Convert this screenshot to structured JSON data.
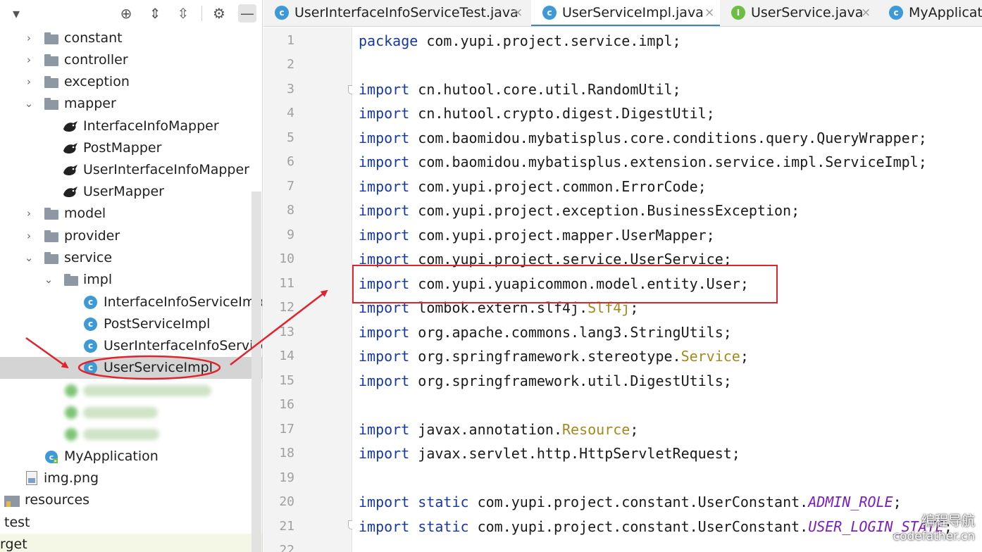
{
  "toolbar": {
    "icons": [
      "chevron-down-icon",
      "crosshair-icon",
      "expand-all-icon",
      "collapse-all-icon",
      "gear-icon",
      "minimize-icon"
    ]
  },
  "tree": {
    "constant": "constant",
    "controller": "controller",
    "exception": "exception",
    "mapper": "mapper",
    "interface_info_mapper": "InterfaceInfoMapper",
    "post_mapper": "PostMapper",
    "user_interface_info_mapper": "UserInterfaceInfoMapper",
    "user_mapper": "UserMapper",
    "model": "model",
    "provider": "provider",
    "service": "service",
    "impl": "impl",
    "interface_info_service_impl": "InterfaceInfoServiceImpl",
    "post_service_impl": "PostServiceImpl",
    "user_interface_info_service_impl": "UserInterfaceInfoServiceImpl",
    "user_service_impl": "UserServiceImpl",
    "my_application": "MyApplication",
    "img_png": "img.png",
    "resources": "resources",
    "test": "test",
    "target": "rget"
  },
  "tabs": [
    {
      "label": "UserInterfaceInfoServiceTest.java",
      "icon": "class-icon",
      "active": false,
      "close": "×"
    },
    {
      "label": "UserServiceImpl.java",
      "icon": "class-icon",
      "active": true,
      "close": "×"
    },
    {
      "label": "UserService.java",
      "icon": "interface-icon",
      "active": false,
      "close": "×"
    },
    {
      "label": "MyApplicat",
      "icon": "app-icon",
      "active": false,
      "close": ""
    }
  ],
  "code": {
    "line_numbers": [
      "1",
      "2",
      "3",
      "4",
      "5",
      "6",
      "7",
      "8",
      "9",
      "10",
      "11",
      "12",
      "13",
      "14",
      "15",
      "16",
      "17",
      "18",
      "19",
      "20",
      "21",
      "22"
    ],
    "l1": {
      "kw": "package",
      "rest": " com.yupi.project.service.impl;"
    },
    "l3": {
      "kw": "import",
      "rest": " cn.hutool.core.util.RandomUtil;"
    },
    "l4": {
      "kw": "import",
      "rest": " cn.hutool.crypto.digest.DigestUtil;"
    },
    "l5": {
      "kw": "import",
      "rest": " com.baomidou.mybatisplus.core.conditions.query.QueryWrapper;"
    },
    "l6": {
      "kw": "import",
      "rest": " com.baomidou.mybatisplus.extension.service.impl.ServiceImpl;"
    },
    "l7": {
      "kw": "import",
      "rest": " com.yupi.project.common.ErrorCode;"
    },
    "l8": {
      "kw": "import",
      "rest": " com.yupi.project.exception.BusinessException;"
    },
    "l9": {
      "kw": "import",
      "rest": " com.yupi.project.mapper.UserMapper;"
    },
    "l10": {
      "kw": "import",
      "rest": " com.yupi.project.service.UserService;"
    },
    "l11": {
      "kw": "import",
      "rest": " com.yupi.yuapicommon.model.entity.User;"
    },
    "l12": {
      "kw": "import",
      "pre": " lombok.extern.slf4j.",
      "ann": "Slf4j",
      "post": ";"
    },
    "l13": {
      "kw": "import",
      "rest": " org.apache.commons.lang3.StringUtils;"
    },
    "l14": {
      "kw": "import",
      "pre": " org.springframework.stereotype.",
      "ann": "Service",
      "post": ";"
    },
    "l15": {
      "kw": "import",
      "rest": " org.springframework.util.DigestUtils;"
    },
    "l17": {
      "kw": "import",
      "pre": " javax.annotation.",
      "ann": "Resource",
      "post": ";"
    },
    "l18": {
      "kw": "import",
      "rest": " javax.servlet.http.HttpServletRequest;"
    },
    "l20": {
      "kw": "import",
      "kw2": "static",
      "pre": " com.yupi.project.constant.UserConstant.",
      "stat": "ADMIN_ROLE",
      "post": ";"
    },
    "l21": {
      "kw": "import",
      "kw2": "static",
      "pre": " com.yupi.project.constant.UserConstant.",
      "stat": "USER_LOGIN_STATE",
      "post": ";"
    }
  },
  "watermark": {
    "line1": "编程导航",
    "line2": "codefather.cn"
  },
  "colors": {
    "annotation_red": "#e0242b",
    "keyword": "#1638a8",
    "selection": "#d4d4d4",
    "active_tab_underline": "#4083c9"
  }
}
